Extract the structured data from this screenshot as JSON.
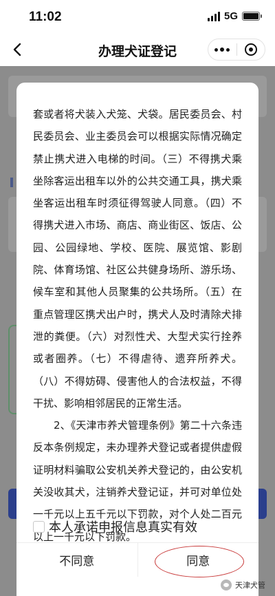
{
  "status_bar": {
    "time": "11:02",
    "network": "5G",
    "signal_bars": 4,
    "battery_level": 1.0
  },
  "nav": {
    "title": "办理犬证登记",
    "back_icon": "chevron-left-icon",
    "more_icon": "more-dots-icon",
    "close_icon": "close-circle-icon"
  },
  "dialog": {
    "paragraphs": [
      {
        "indent": false,
        "text": "套或者将犬装入犬笼、犬袋。居民委员会、村民委员会、业主委员会可以根据实际情况确定禁止携犬进入电梯的时间。（三）不得携犬乘坐除客运出租车以外的公共交通工具，携犬乘坐客运出租车时须征得驾驶人同意。（四）不得携犬进入市场、商店、商业街区、饭店、公园、公园绿地、学校、医院、展览馆、影剧院、体育场馆、社区公共健身场所、游乐场、候车室和其他人员聚集的公共场所。（五）在重点管理区携犬出户时，携犬人及时清除犬排泄的粪便。（六）对烈性犬、大型犬实行拴养或者圈养。（七）不得虐待、遗弃所养犬。（八）不得妨碍、侵害他人的合法权益，不得干扰、影响相邻居民的正常生活。"
      },
      {
        "indent": true,
        "text": "2、《天津市养犬管理条例》第二十六条违反本条例规定，未办理养犬登记或者提供虚假证明材料骗取公安机关养犬登记的，由公安机关没收其犬，注销养犬登记证，并可对单位处一千元以上五千元以下罚款，对个人处二百元以上一千元以下罚款。"
      }
    ],
    "checkbox_checked": false,
    "checkbox_label": "本人承诺申报信息真实有效",
    "disagree_label": "不同意",
    "agree_label": "同意",
    "highlight_color": "#c83a3a"
  },
  "watermark": {
    "text": "天津犬管"
  },
  "colors": {
    "overlay": "#8c8c8c",
    "primary_button": "#2b3f8c"
  }
}
